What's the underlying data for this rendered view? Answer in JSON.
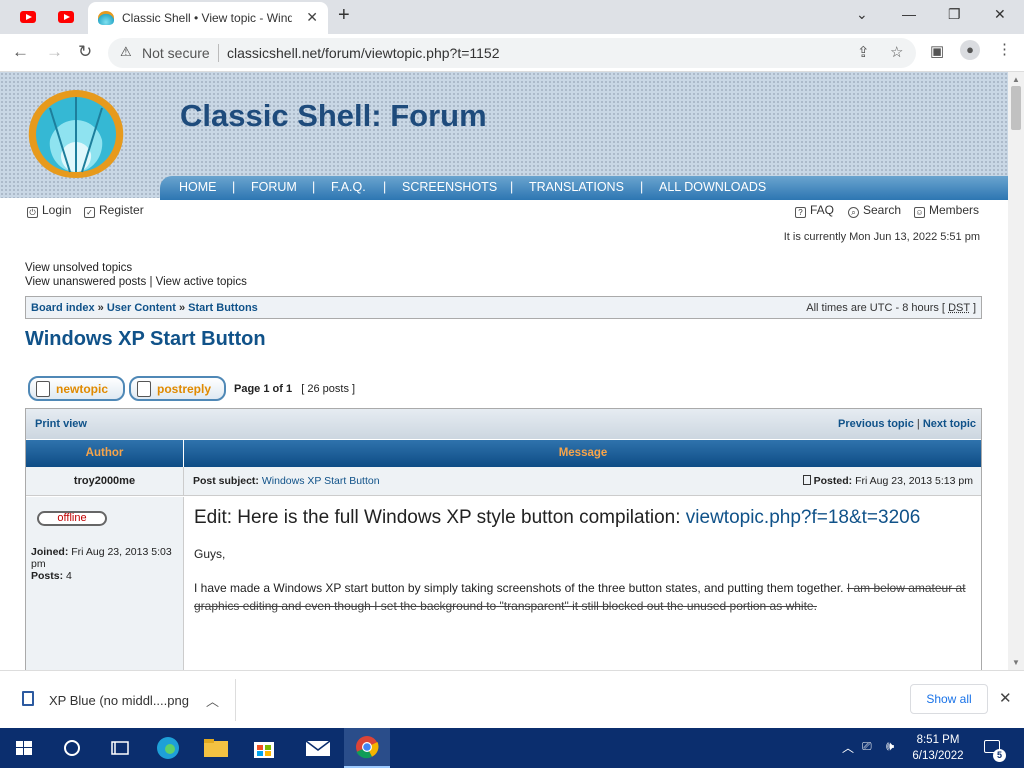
{
  "browser": {
    "tab_title": "Classic Shell • View topic - Windows XP Start Button",
    "new_tab": "+",
    "not_secure": "Not secure",
    "url": "classicshell.net/forum/viewtopic.php?t=1152",
    "win_min": "⌄",
    "win_min2": "—",
    "win_max": "❐",
    "win_close": "✕"
  },
  "header": {
    "site_title": "Classic Shell: Forum",
    "nav": [
      "HOME",
      "FORUM",
      "F.A.Q.",
      "SCREENSHOTS",
      "TRANSLATIONS",
      "ALL DOWNLOADS"
    ],
    "nav_sep": "|"
  },
  "userbar": {
    "login": "Login",
    "register": "Register",
    "faq": "FAQ",
    "search": "Search",
    "members": "Members",
    "current_time": "It is currently Mon Jun 13, 2022 5:51 pm"
  },
  "links": {
    "unsolved": "View unsolved topics",
    "unanswered": "View unanswered posts",
    "sep": "|",
    "active": "View active topics"
  },
  "breadcrumb": {
    "items": [
      "Board index",
      "User Content",
      "Start Buttons"
    ],
    "sep": "»",
    "timezone": "All times are UTC - 8 hours [",
    "dst": "DST",
    "timezone_end": "]"
  },
  "topic": {
    "title": "Windows XP Start Button",
    "new_topic": "newtopic",
    "post_reply": "postreply",
    "page_info": "Page 1 of 1",
    "post_count": "[ 26 posts ]",
    "print_view": "Print view",
    "prev_topic": "Previous topic",
    "next_topic": "Next topic",
    "topic_nav_sep": "|",
    "col_author": "Author",
    "col_message": "Message"
  },
  "post": {
    "author": "troy2000me",
    "subject_label": "Post subject:",
    "subject": "Windows XP Start Button",
    "posted_label": "Posted:",
    "posted": "Fri Aug 23, 2013 5:13 pm",
    "status": "offline",
    "joined_label": "Joined:",
    "joined": "Fri Aug 23, 2013 5:03 pm",
    "posts_label": "Posts:",
    "posts": "4",
    "heading": "Edit: Here is the full Windows XP style button compilation:",
    "heading_link": "viewtopic.php?f=18&t=3206",
    "greeting": "Guys,",
    "body": "I have made a Windows XP start button by simply taking screenshots of the three button states, and putting them together.",
    "body_struck": "I am below amateur at graphics editing and even though I set the background to \"transparent\" it still blocked out the unused portion as white."
  },
  "downloads": {
    "file": "XP Blue (no middl....png",
    "show_all": "Show all"
  },
  "taskbar": {
    "time": "8:51 PM",
    "date": "6/13/2022",
    "notifications": "5"
  },
  "colors": {
    "link": "#105289",
    "nav_blue": "#2d76b2",
    "accent_orange": "#f7a44a",
    "taskbar": "#0b2e6e"
  }
}
